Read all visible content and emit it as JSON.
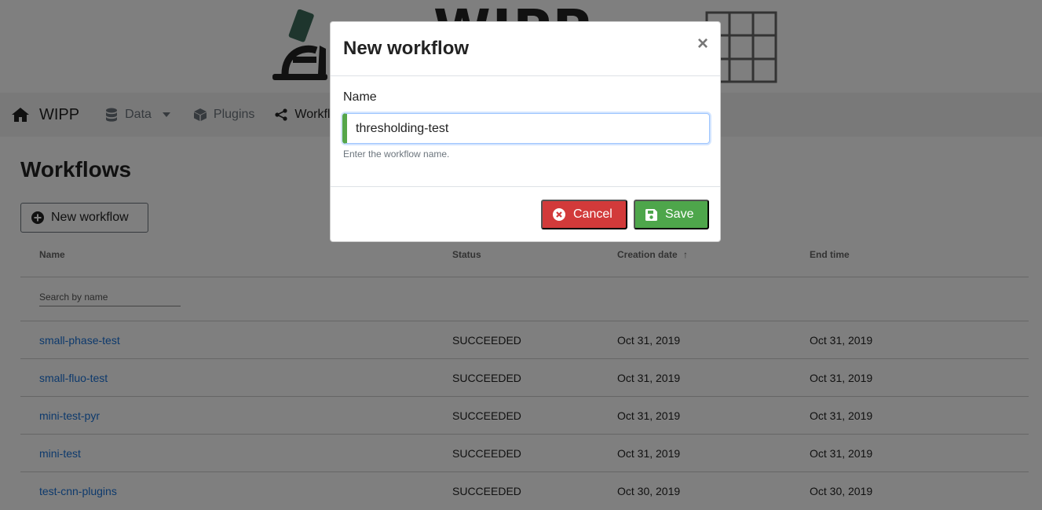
{
  "header": {
    "logo_text": "WIPP"
  },
  "navbar": {
    "brand": "WIPP",
    "items": [
      {
        "label": "Data",
        "icon": "database-icon"
      },
      {
        "label": "Plugins",
        "icon": "box-icon"
      },
      {
        "label": "Workflow",
        "icon": "share-icon"
      }
    ]
  },
  "page": {
    "title": "Workflows",
    "new_button": "New workflow"
  },
  "table": {
    "columns": [
      "Name",
      "Status",
      "Creation date",
      "End time"
    ],
    "search_placeholder": "Search by name",
    "sort_column": "Creation date",
    "rows": [
      {
        "name": "small-phase-test",
        "status": "SUCCEEDED",
        "created": "Oct 31, 2019",
        "ended": "Oct 31, 2019"
      },
      {
        "name": "small-fluo-test",
        "status": "SUCCEEDED",
        "created": "Oct 31, 2019",
        "ended": "Oct 31, 2019"
      },
      {
        "name": "mini-test-pyr",
        "status": "SUCCEEDED",
        "created": "Oct 31, 2019",
        "ended": "Oct 31, 2019"
      },
      {
        "name": "mini-test",
        "status": "SUCCEEDED",
        "created": "Oct 31, 2019",
        "ended": "Oct 31, 2019"
      },
      {
        "name": "test-cnn-plugins",
        "status": "SUCCEEDED",
        "created": "Oct 30, 2019",
        "ended": "Oct 30, 2019"
      }
    ]
  },
  "modal": {
    "title": "New workflow",
    "close": "×",
    "field_label": "Name",
    "field_value": "thresholding-test",
    "field_help": "Enter the workflow name.",
    "cancel_label": "Cancel",
    "save_label": "Save"
  },
  "colors": {
    "cancel": "#d23a3a",
    "save": "#4ea64b",
    "link": "#1a73d9",
    "input_valid": "#56a64a"
  }
}
